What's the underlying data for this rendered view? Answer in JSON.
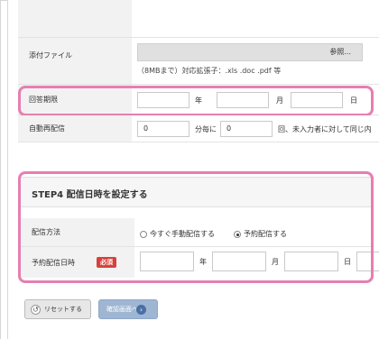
{
  "attachment": {
    "label": "添付ファイル",
    "browse_label": "参照...",
    "hint": "（8MBまで）対応拡張子：.xls .doc .pdf 等"
  },
  "deadline": {
    "label": "回答期限",
    "year_unit": "年",
    "month_unit": "月",
    "day_unit": "日"
  },
  "auto_resend": {
    "label": "自動再配信",
    "days_value": "0",
    "days_suffix": "分毎に",
    "count_value": "0",
    "count_suffix": "回、未入力者に対して同じ内"
  },
  "step4": {
    "title": "STEP4 配信日時を設定する",
    "method_label": "配信方法",
    "option_now": "今すぐ手動配信する",
    "option_scheduled": "予約配信する",
    "selected": "予約配信する",
    "schedule_label": "予約配信日時",
    "required_badge": "必須",
    "year_unit": "年",
    "month_unit": "月",
    "day_unit": "日"
  },
  "buttons": {
    "reset_label": "リセットする",
    "confirm_label": "確認画面へ"
  },
  "colors": {
    "highlight": "#e57fb2",
    "required": "#d9403b",
    "confirm_button": "#9fb6d3"
  }
}
